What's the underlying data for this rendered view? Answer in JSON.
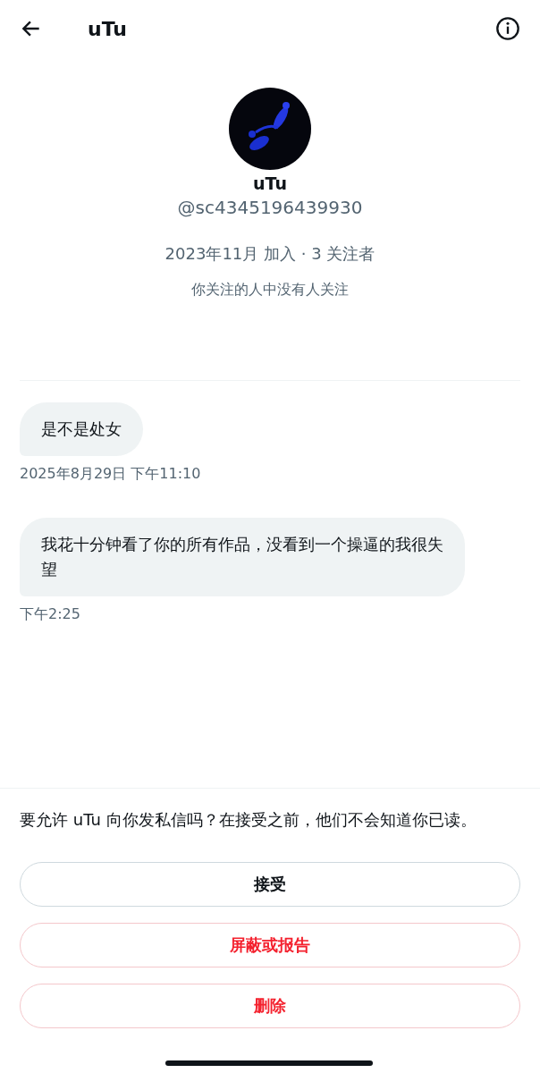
{
  "header": {
    "title": "uTu"
  },
  "profile": {
    "name": "uTu",
    "handle": "@sc4345196439930",
    "meta": "2023年11月 加入 · 3 关注者",
    "note": "你关注的人中没有人关注"
  },
  "messages": [
    {
      "text": "是不是处女",
      "time": "2025年8月29日 下午11:10"
    },
    {
      "text": "我花十分钟看了你的所有作品，没看到一个操逼的我很失望",
      "time": "下午2:25"
    }
  ],
  "request": {
    "prompt": "要允许 uTu 向你发私信吗？在接受之前，他们不会知道你已读。",
    "buttons": [
      {
        "label": "接受",
        "kind": "primary"
      },
      {
        "label": "屏蔽或报告",
        "kind": "danger"
      },
      {
        "label": "删除",
        "kind": "danger"
      }
    ]
  }
}
